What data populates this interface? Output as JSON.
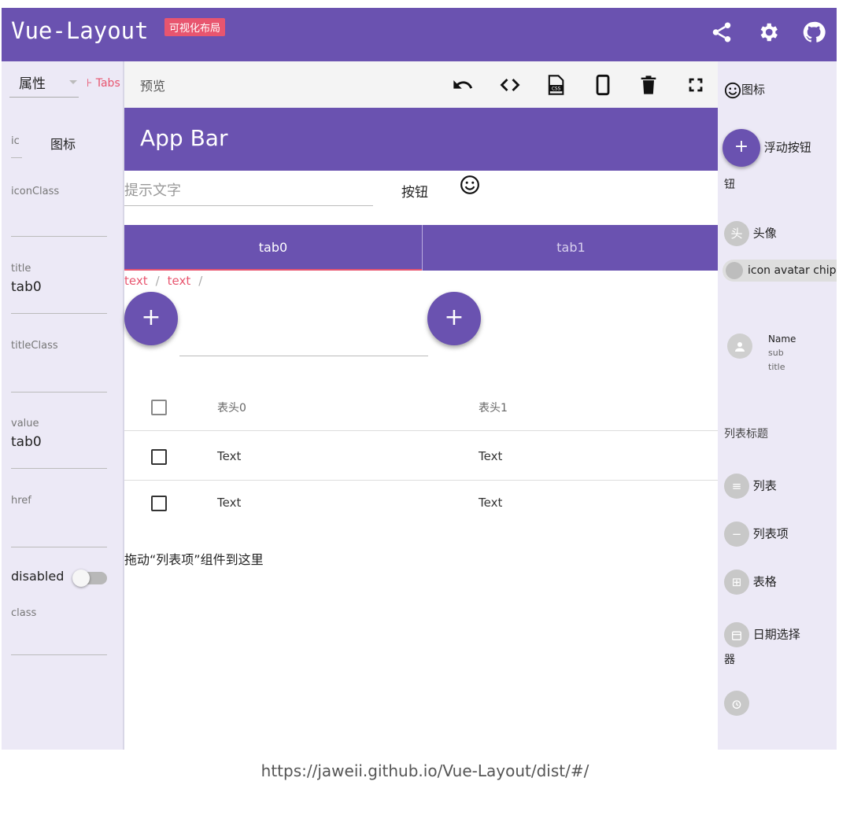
{
  "header": {
    "brand": "Vue-Layout",
    "badge": "可视化布局"
  },
  "left_panel": {
    "tab_label": "属性",
    "tabs_link": "⊦ Tabs",
    "fields": [
      {
        "label": "ic",
        "value": "图标"
      },
      {
        "label": "iconClass",
        "value": ""
      },
      {
        "label": "title",
        "value": "tab0"
      },
      {
        "label": "titleClass",
        "value": ""
      },
      {
        "label": "value",
        "value": "tab0"
      },
      {
        "label": "href",
        "value": ""
      },
      {
        "label": "disabled",
        "value": ""
      },
      {
        "label": "class",
        "value": ""
      }
    ]
  },
  "toolbar": {
    "title": "预览"
  },
  "canvas": {
    "app_bar": "App Bar",
    "input_placeholder": "提示文字",
    "button_label": "按钮",
    "tabs": [
      "tab0",
      "tab1"
    ],
    "breadcrumbs": [
      "text",
      "text"
    ],
    "fab_symbol": "+",
    "table": {
      "headers": [
        "表头0",
        "表头1"
      ],
      "rows": [
        [
          "Text",
          "Text"
        ],
        [
          "Text",
          "Text"
        ]
      ]
    },
    "drop_hint": "拖动“列表项”组件到这里"
  },
  "right_panel": {
    "icon_item": "图标",
    "fab_item": "浮动按钮",
    "fab_item_wrap": "钮",
    "avatar_item": "头像",
    "avatar_glyph": "头",
    "chip_item": "icon avatar chip",
    "list_name": "Name",
    "list_sub": "sub",
    "list_title": "title",
    "list_header": "列表标题",
    "list_item": "列表",
    "list_row_item": "列表项",
    "table_item": "表格",
    "date_item": "日期选择",
    "date_item_wrap": "器"
  },
  "footer": {
    "url": "https://jaweii.github.io/Vue-Layout/dist/#/"
  }
}
